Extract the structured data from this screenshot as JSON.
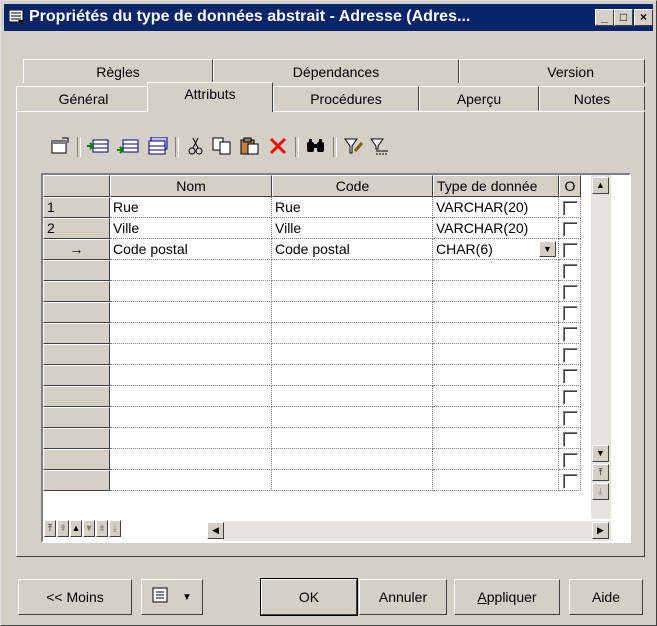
{
  "window": {
    "title": "Propriétés du type de données abstrait - Adresse (Adres...",
    "controls": {
      "min": "_",
      "max": "□",
      "close": "×"
    }
  },
  "tabs_row1": [
    {
      "label": "Règles"
    },
    {
      "label": "Dépendances"
    },
    {
      "label": "Version"
    }
  ],
  "tabs_row2": [
    {
      "label": "Général"
    },
    {
      "label": "Attributs",
      "active": true
    },
    {
      "label": "Procédures"
    },
    {
      "label": "Aperçu"
    },
    {
      "label": "Notes"
    }
  ],
  "toolbar": {
    "icons": [
      "properties-icon",
      "insert-row-icon",
      "add-row-icon",
      "add-rows-icon",
      "cut-icon",
      "copy-icon",
      "paste-icon",
      "delete-icon",
      "find-icon",
      "filter-icon",
      "filter-clear-icon"
    ]
  },
  "grid": {
    "columns": [
      "Nom",
      "Code",
      "Type de donnée",
      "O"
    ],
    "rows": [
      {
        "num": "1",
        "nom": "Rue",
        "code": "Rue",
        "type": "VARCHAR(20)"
      },
      {
        "num": "2",
        "nom": "Ville",
        "code": "Ville",
        "type": "VARCHAR(20)"
      },
      {
        "num": "→",
        "nom": "Code postal",
        "code": "Code postal",
        "type": "CHAR(6)"
      }
    ],
    "empty_rows": 11
  },
  "buttons": {
    "less": "<< Moins",
    "ok": "OK",
    "cancel": "Annuler",
    "apply_prefix": "A",
    "apply_rest": "ppliquer",
    "help": "Aide"
  }
}
